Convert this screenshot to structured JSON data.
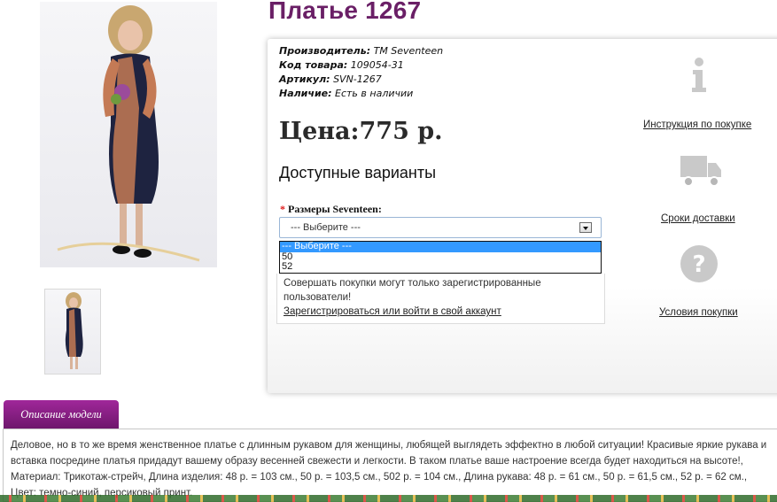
{
  "product": {
    "title": "Платье 1267",
    "manufacturer_label": "Производитель:",
    "manufacturer": "ТМ Seventeen",
    "code_label": "Код товара:",
    "code": "109054-31",
    "article_label": "Артикул:",
    "article": "SVN-1267",
    "availability_label": "Наличие:",
    "availability": "Есть в наличии",
    "price": "Цена:775 р."
  },
  "options": {
    "heading": "Доступные варианты",
    "size_label": "Размеры Seventeen:",
    "required_mark": "*",
    "select_value": "--- Выберите ---",
    "dropdown": [
      "--- Выберите ---",
      "50",
      "52"
    ]
  },
  "notice": {
    "text": "Совершать покупки могут только зарегистрированные пользователи!",
    "link": "Зарегистрироваться или войти в свой аккаунт"
  },
  "sidebar": {
    "items": [
      {
        "icon": "info-icon",
        "label": "Инструкция по покупке"
      },
      {
        "icon": "delivery-truck-icon",
        "label": "Сроки доставки"
      },
      {
        "icon": "question-icon",
        "label": "Условия покупки"
      }
    ]
  },
  "description": {
    "tab": "Описание модели",
    "text": "Деловое, но в то же время женственное платье с длинным рукавом для женщины, любящей выглядеть эффектно в любой ситуации! Красивые яркие рукава и вставка посредине платья придадут вашему образу весенней свежести и легкости. В таком платье ваше настроение всегда будет находиться на высоте!, Материал: Трикотаж-стрейч, Длина изделия: 48 р. = 103 см., 50 р. = 103,5 см., 502 р. = 104 см., Длина рукава: 48 р. = 61 см., 50 р. = 61,5 см., 52 р. = 62 см., Цвет: темно-синий, персиковый принт."
  },
  "colors": {
    "title": "#6a1f66",
    "tab": "#8c2088",
    "required": "#e02020",
    "selected_option": "#3399ff"
  }
}
